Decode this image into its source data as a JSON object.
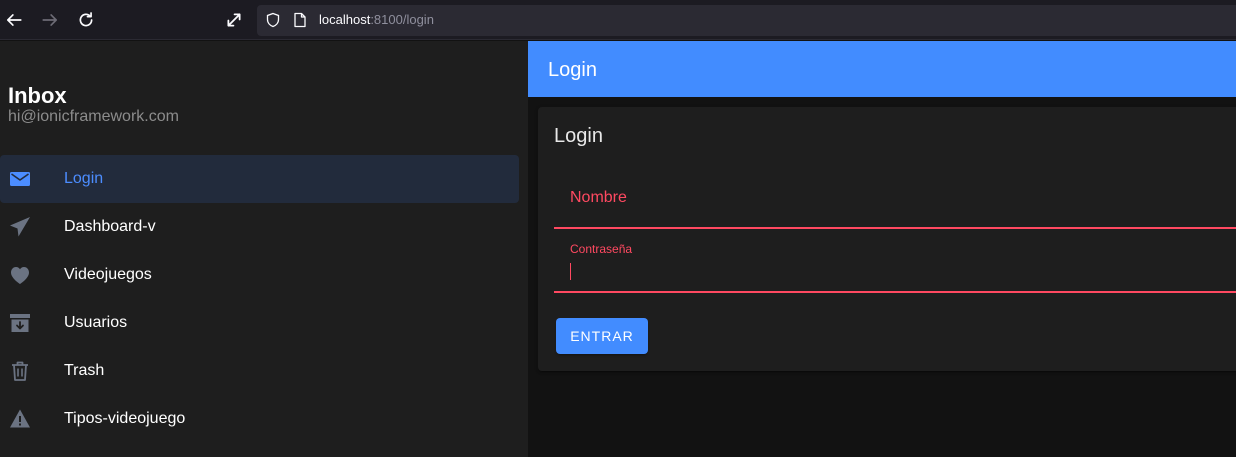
{
  "browser": {
    "url_host": "localhost",
    "url_rest": ":8100/login"
  },
  "menu": {
    "title": "Inbox",
    "note": "hi@ionicframework.com",
    "items": [
      {
        "label": "Login",
        "icon": "mail-icon",
        "selected": true
      },
      {
        "label": "Dashboard-v",
        "icon": "paper-plane-icon",
        "selected": false
      },
      {
        "label": "Videojuegos",
        "icon": "heart-icon",
        "selected": false
      },
      {
        "label": "Usuarios",
        "icon": "archive-icon",
        "selected": false
      },
      {
        "label": "Trash",
        "icon": "trash-icon",
        "selected": false
      },
      {
        "label": "Tipos-videojuego",
        "icon": "warning-icon",
        "selected": false
      }
    ]
  },
  "header": {
    "title": "Login"
  },
  "card": {
    "title": "Login",
    "nombre_placeholder": "Nombre",
    "password_label": "Contraseña",
    "submit_label": "ENTRAR"
  },
  "colors": {
    "primary": "#428cff",
    "danger": "#ff4961",
    "selected_bg": "#222b3c",
    "menu_bg": "#1e1e1e",
    "content_bg": "#121212"
  }
}
